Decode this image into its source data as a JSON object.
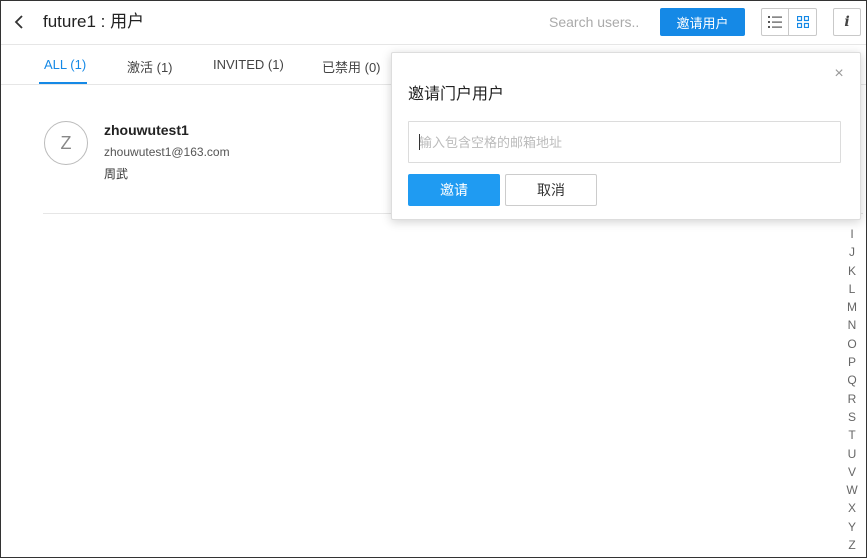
{
  "header": {
    "title": "future1 : 用户",
    "search_placeholder": "Search users..",
    "invite_label": "邀请用户",
    "info_label": "i"
  },
  "tabs": [
    {
      "label": "ALL (1)",
      "active": true
    },
    {
      "label": "激活 (1)",
      "active": false
    },
    {
      "label": "INVITED (1)",
      "active": false
    },
    {
      "label": "已禁用 (0)",
      "active": false
    }
  ],
  "user": {
    "initial": "Z",
    "username": "zhouwutest1",
    "email": "zhouwutest1@163.com",
    "real_name": "周武"
  },
  "alphabet": [
    "I",
    "J",
    "K",
    "L",
    "M",
    "N",
    "O",
    "P",
    "Q",
    "R",
    "S",
    "T",
    "U",
    "V",
    "W",
    "X",
    "Y",
    "Z"
  ],
  "popup": {
    "title": "邀请门户用户",
    "close_label": "×",
    "input_placeholder": "输入包含空格的邮箱地址",
    "ok_label": "邀请",
    "cancel_label": "取消"
  },
  "colors": {
    "accent": "#1589e6",
    "primary_button": "#1f9bf2"
  }
}
